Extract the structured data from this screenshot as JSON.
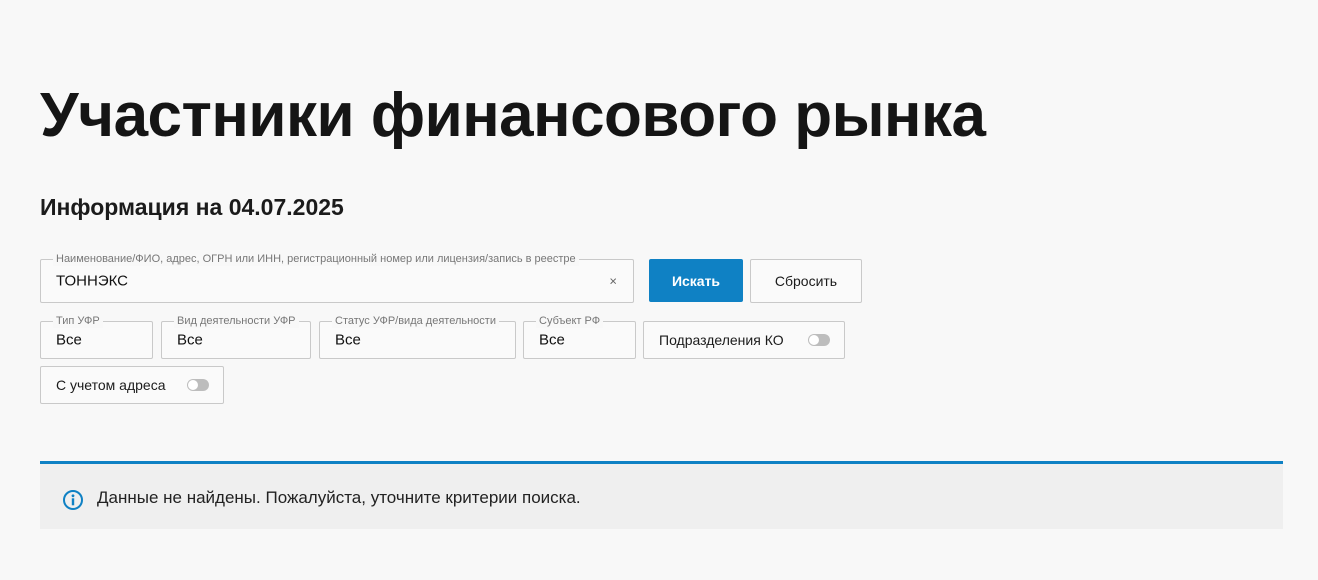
{
  "page": {
    "title": "Участники финансового рынка",
    "info_date": "Информация на 04.07.2025"
  },
  "search": {
    "legend": "Наименование/ФИО, адрес, ОГРН или ИНН, регистрационный номер или лицензия/запись в реестре",
    "value": "ТОННЭКС",
    "clear_icon": "×",
    "search_label": "Искать",
    "reset_label": "Сбросить"
  },
  "filters": {
    "ufr_type": {
      "legend": "Тип УФР",
      "value": "Все"
    },
    "activity": {
      "legend": "Вид деятельности УФР",
      "value": "Все"
    },
    "status": {
      "legend": "Статус УФР/вида деятельности",
      "value": "Все"
    },
    "region": {
      "legend": "Субъект РФ",
      "value": "Все"
    },
    "ko_units": {
      "label": "Подразделения КО",
      "enabled": false
    },
    "with_address": {
      "label": "С учетом адреса",
      "enabled": false
    }
  },
  "alert": {
    "icon": "info-icon",
    "message": "Данные не найдены. Пожалуйста, уточните критерии поиска."
  },
  "colors": {
    "accent": "#0f81c4",
    "background": "#f8f8f8",
    "alert_background": "#efefef"
  }
}
